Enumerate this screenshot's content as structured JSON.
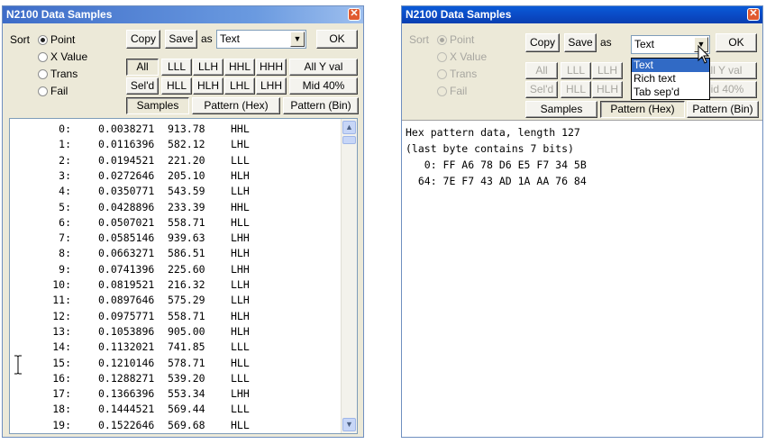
{
  "left": {
    "title": "N2100 Data Samples",
    "sort_label": "Sort",
    "radios": [
      "Point",
      "X Value",
      "Trans",
      "Fail"
    ],
    "copy": "Copy",
    "save": "Save",
    "as": "as",
    "format": "Text",
    "ok": "OK",
    "filter_row1": [
      "All",
      "LLL",
      "LLH",
      "HHL",
      "HHH",
      "All Y val"
    ],
    "filter_row2": [
      "Sel'd",
      "HLL",
      "HLH",
      "LHL",
      "LHH",
      "Mid 40%"
    ],
    "tabs": [
      "Samples",
      "Pattern (Hex)",
      "Pattern (Bin)"
    ],
    "samples": [
      {
        "i": "0:",
        "x": "0.0038271",
        "y": "913.78",
        "p": "HHL"
      },
      {
        "i": "1:",
        "x": "0.0116396",
        "y": "582.12",
        "p": "LHL"
      },
      {
        "i": "2:",
        "x": "0.0194521",
        "y": "221.20",
        "p": "LLL"
      },
      {
        "i": "3:",
        "x": "0.0272646",
        "y": "205.10",
        "p": "HLH"
      },
      {
        "i": "4:",
        "x": "0.0350771",
        "y": "543.59",
        "p": "LLH"
      },
      {
        "i": "5:",
        "x": "0.0428896",
        "y": "233.39",
        "p": "HHL"
      },
      {
        "i": "6:",
        "x": "0.0507021",
        "y": "558.71",
        "p": "HLL"
      },
      {
        "i": "7:",
        "x": "0.0585146",
        "y": "939.63",
        "p": "LHH"
      },
      {
        "i": "8:",
        "x": "0.0663271",
        "y": "586.51",
        "p": "HLH"
      },
      {
        "i": "9:",
        "x": "0.0741396",
        "y": "225.60",
        "p": "LHH"
      },
      {
        "i": "10:",
        "x": "0.0819521",
        "y": "216.32",
        "p": "LLH"
      },
      {
        "i": "11:",
        "x": "0.0897646",
        "y": "575.29",
        "p": "LLH"
      },
      {
        "i": "12:",
        "x": "0.0975771",
        "y": "558.71",
        "p": "HLH"
      },
      {
        "i": "13:",
        "x": "0.1053896",
        "y": "905.00",
        "p": "HLH"
      },
      {
        "i": "14:",
        "x": "0.1132021",
        "y": "741.85",
        "p": "LLL"
      },
      {
        "i": "15:",
        "x": "0.1210146",
        "y": "578.71",
        "p": "HLL"
      },
      {
        "i": "16:",
        "x": "0.1288271",
        "y": "539.20",
        "p": "LLL"
      },
      {
        "i": "17:",
        "x": "0.1366396",
        "y": "553.34",
        "p": "LHH"
      },
      {
        "i": "18:",
        "x": "0.1444521",
        "y": "569.44",
        "p": "LLL"
      },
      {
        "i": "19:",
        "x": "0.1522646",
        "y": "569.68",
        "p": "HLL"
      }
    ]
  },
  "right": {
    "title": "N2100 Data Samples",
    "sort_label": "Sort",
    "radios": [
      "Point",
      "X Value",
      "Trans",
      "Fail"
    ],
    "copy": "Copy",
    "save": "Save",
    "as": "as",
    "format": "Text",
    "ok": "OK",
    "filter_row1": [
      "All",
      "LLL",
      "LLH",
      "All Y val"
    ],
    "filter_row2": [
      "Sel'd",
      "HLL",
      "HLH",
      "Mid 40%"
    ],
    "tabs": [
      "Samples",
      "Pattern (Hex)",
      "Pattern (Bin)"
    ],
    "dropdown_options": [
      "Text",
      "Rich text",
      "Tab sep'd"
    ],
    "hex_lines": [
      "Hex pattern data, length 127",
      "(last byte contains 7 bits)",
      "   0: FF A6 78 D6 E5 F7 34 5B",
      "  64: 7E F7 43 AD 1A AA 76 84"
    ]
  }
}
